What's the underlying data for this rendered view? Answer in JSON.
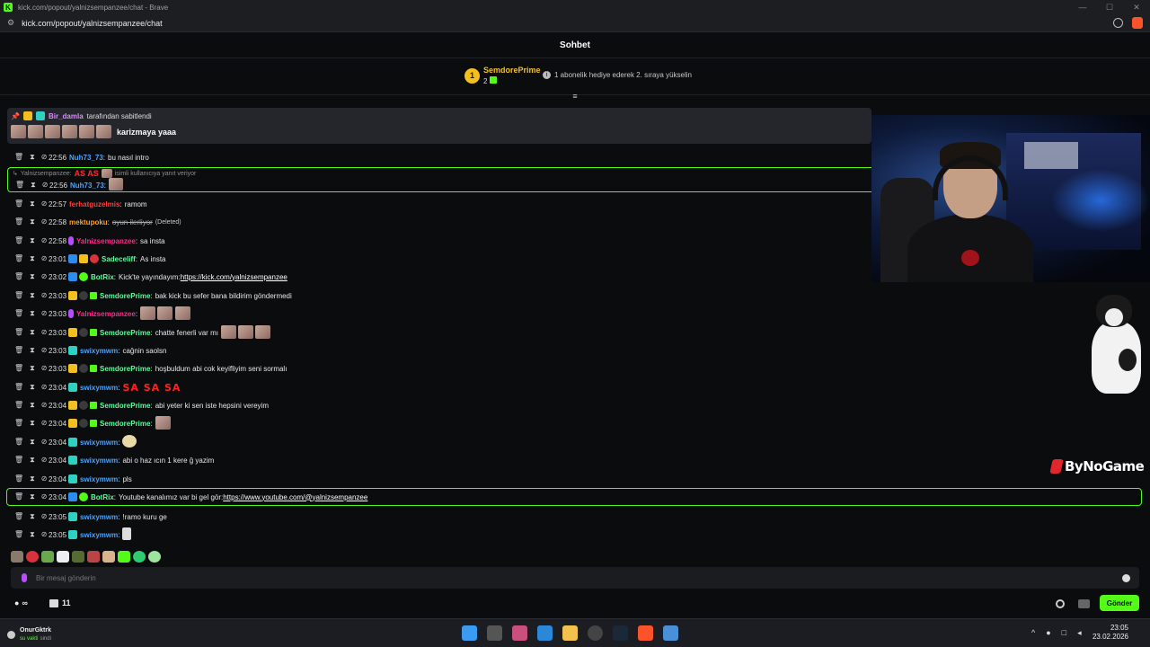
{
  "browser": {
    "window_title": "kick.com/popout/yalnizsempanzee/chat - Brave",
    "url": "kick.com/popout/yalnizsempanzee/chat",
    "favicon": "K"
  },
  "chat": {
    "header": "Sohbet",
    "top_gifter": {
      "rank": "1",
      "name": "SemdorePrime",
      "count": "2"
    },
    "gift_tip": "1 abonelik hediye ederek 2. sıraya yükselin",
    "pinned": {
      "pinned_by": "Bir_damla",
      "pinned_label": "tarafından sabitlendi",
      "text": "karizmaya yaaa"
    },
    "reply": {
      "to_user": "Yalnizsempanzee:",
      "as_text": "AS AS",
      "suffix": "isimli kullanıcıya yanıt veriyor"
    },
    "messages": [
      {
        "time": "22:56",
        "user": "Nuh73_73",
        "text": "bu nasıl intro"
      },
      {
        "time": "22:56",
        "user": "Nuh73_73",
        "text": ""
      },
      {
        "time": "22:57",
        "user": "ferhatguzelmis",
        "text": "ramom"
      },
      {
        "time": "22:58",
        "user": "mektupoku",
        "text": "oyun ilerliyor",
        "tag": "(Deleted)"
      },
      {
        "time": "22:58",
        "user": "Yalnizsempanzee",
        "text": "sa insta"
      },
      {
        "time": "23:01",
        "user": "Sadeceliff",
        "text": "As insta"
      },
      {
        "time": "23:02",
        "user": "BotRix",
        "text": "Kick'te yayındayım: ",
        "link": "https://kick.com/yalnizsempanzee"
      },
      {
        "time": "23:03",
        "user": "SemdorePrime",
        "text": "bak kick bu sefer bana bildirim göndermedi"
      },
      {
        "time": "23:03",
        "user": "Yalnizsempanzee",
        "text": ""
      },
      {
        "time": "23:03",
        "user": "SemdorePrime",
        "text": "chatte fenerli var mı"
      },
      {
        "time": "23:03",
        "user": "swixymwm",
        "text": "cağnin saolsn"
      },
      {
        "time": "23:03",
        "user": "SemdorePrime",
        "text": "hoşbuldum abi cok keyifliyim seni sormalı"
      },
      {
        "time": "23:04",
        "user": "swixymwm",
        "text": "SA SA SA"
      },
      {
        "time": "23:04",
        "user": "SemdorePrime",
        "text": "abi yeter ki sen iste hepsini vereyim"
      },
      {
        "time": "23:04",
        "user": "SemdorePrime",
        "text": ""
      },
      {
        "time": "23:04",
        "user": "swixymwm",
        "text": ""
      },
      {
        "time": "23:04",
        "user": "swixymwm",
        "text": "abi o haz ıcın 1 kere ğ yazim"
      },
      {
        "time": "23:04",
        "user": "swixymwm",
        "text": "pls"
      },
      {
        "time": "23:04",
        "user": "BotRix",
        "text": "Youtube kanalımız var bi gel gör: ",
        "link": "https://www.youtube.com/@yalnizsempanzee"
      },
      {
        "time": "23:05",
        "user": "swixymwm",
        "text": "!ramo kuru ge"
      },
      {
        "time": "23:05",
        "user": "swixymwm",
        "text": ""
      }
    ],
    "input_placeholder": "Bir mesaj gönderin",
    "gift_count": "11",
    "send_label": "Gönder",
    "points_symbol": "∞"
  },
  "overlay": {
    "sponsor": "ByNoGame"
  },
  "taskbar": {
    "weather_title": "OnurGktrk",
    "weather_status": "su vakti",
    "weather_sub": "sindi",
    "time": "23:05",
    "date": "23.02.2026"
  },
  "colors": {
    "kick_green": "#53fc18",
    "gold": "#f4c01f",
    "username_blue": "#4aa3ff",
    "username_green": "#58ff9a",
    "username_red": "#ff3c3c"
  }
}
